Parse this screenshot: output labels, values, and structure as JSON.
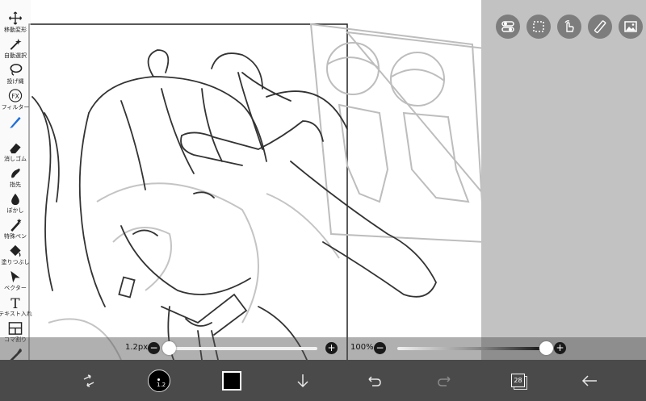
{
  "toolbar": {
    "items": [
      {
        "label": "移動変形",
        "icon": "move-transform-icon"
      },
      {
        "label": "自動選択",
        "icon": "magic-wand-icon"
      },
      {
        "label": "投げ縄",
        "icon": "lasso-icon"
      },
      {
        "label": "フィルター",
        "icon": "fx-icon"
      },
      {
        "label": "",
        "icon": "pen-icon"
      },
      {
        "label": "消しゴム",
        "icon": "eraser-icon"
      },
      {
        "label": "指先",
        "icon": "finger-icon"
      },
      {
        "label": "ぼかし",
        "icon": "blur-icon"
      },
      {
        "label": "特殊ペン",
        "icon": "special-pen-icon"
      },
      {
        "label": "塗りつぶし",
        "icon": "bucket-icon"
      },
      {
        "label": "ベクター",
        "icon": "vector-icon"
      },
      {
        "label": "テキスト入れ",
        "icon": "text-icon"
      },
      {
        "label": "コマ割り",
        "icon": "frame-divider-icon"
      },
      {
        "label": "スポイト",
        "icon": "eyedropper-icon"
      }
    ]
  },
  "quick_buttons": [
    "toggle-icon",
    "selection-icon",
    "hand-icon",
    "ruler-icon",
    "image-icon"
  ],
  "brush": {
    "size_value": "1.2px",
    "size_fraction": 0.02,
    "opacity_value": "100%",
    "opacity_fraction": 1.0
  },
  "bottom": {
    "brush_preview_label": "1.2",
    "layer_count": "28"
  },
  "colors": {
    "current_color": "#000000",
    "bottom_bar": "#4a4a4a",
    "side_pane": "#c2c2c2"
  }
}
